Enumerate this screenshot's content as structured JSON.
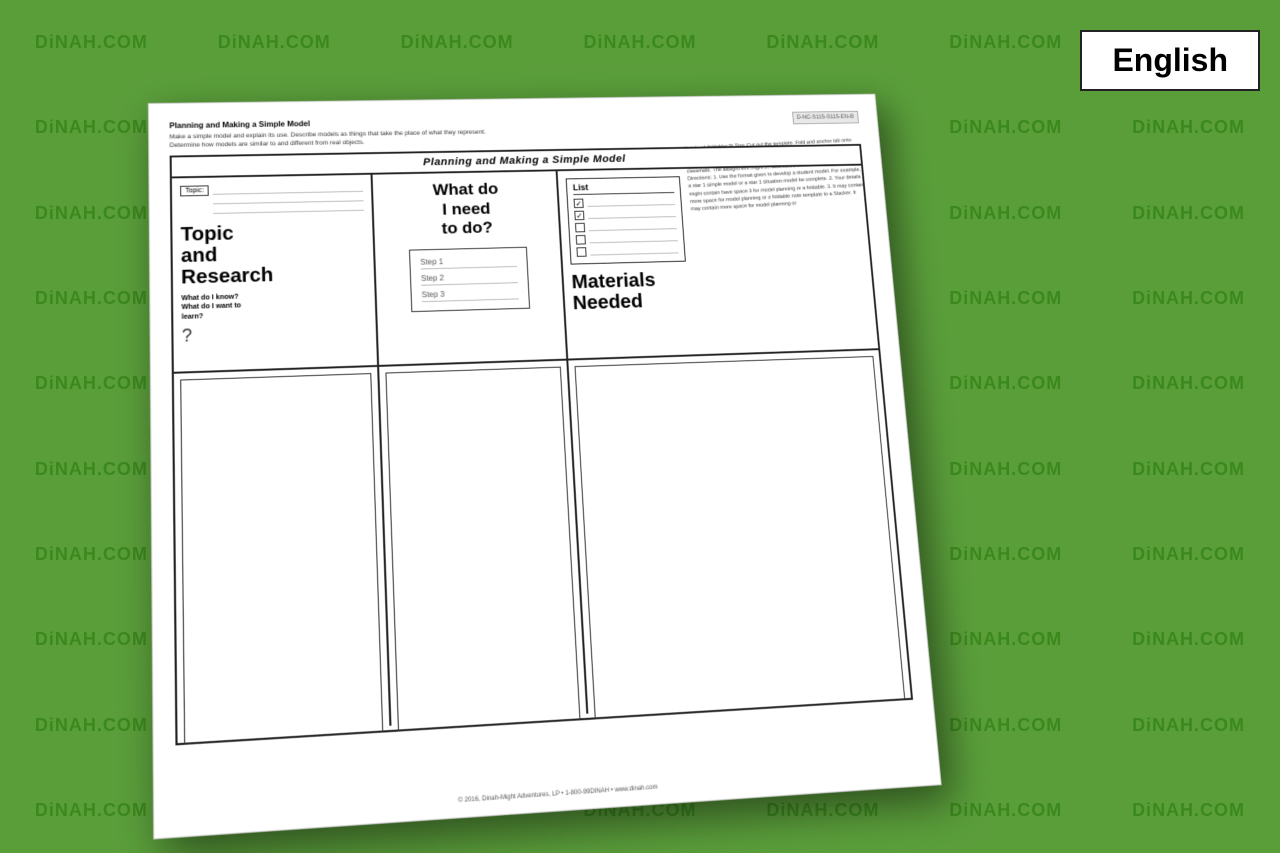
{
  "background": {
    "color": "#5a9e3a",
    "tile_text": "DiNAH.COM",
    "tile_color": "rgba(50,130,20,0.75)"
  },
  "english_button": {
    "label": "English"
  },
  "document": {
    "product_code": "D-NC-S115-S115-EN-B",
    "instruction_title": "Planning and Making a Simple Model",
    "instruction_line1": "Make a simple model and explain its use. Describe models as things that take the place of what they represent.",
    "instruction_line2": "Determine how models are similar to and different from real objects.",
    "planning_title": "Planning and Making a Simple Model",
    "side_instructions": "Notebook foldables™ Tips: Cut out the template. Fold and anchor tab onto notebook page. The anchor tab that the can be given and forward. Glue anchor tab onto notebook page. You may find it helpful to discuss this with classmate. The assignment might be addressed to a student model. Directions: 1. Use the format given to develop a student model. For example, a star 1 simple model or a star 1 situation model be complete. 2. Your details might contain have space 3 for model planning or a foldable. 3. It may contain more space for model planning or a foldable note template to a Stacker. It may contain more space for model planning or",
    "col1": {
      "topic_label": "Topic:",
      "heading": "Topic\nand\nResearch",
      "subheading": "What do I know?\nWhat do I want to\nlearn?",
      "question_mark": "?"
    },
    "col2": {
      "heading": "What do\nI need\nto do?",
      "step1": "Step 1",
      "step2": "Step 2",
      "step3": "Step 3"
    },
    "col3": {
      "list_title": "List",
      "heading": "Materials\nNeeded"
    },
    "footer": "© 2016, Dinah-Might Adventures, LP • 1-800-99DINAH • www.dinah.com"
  }
}
